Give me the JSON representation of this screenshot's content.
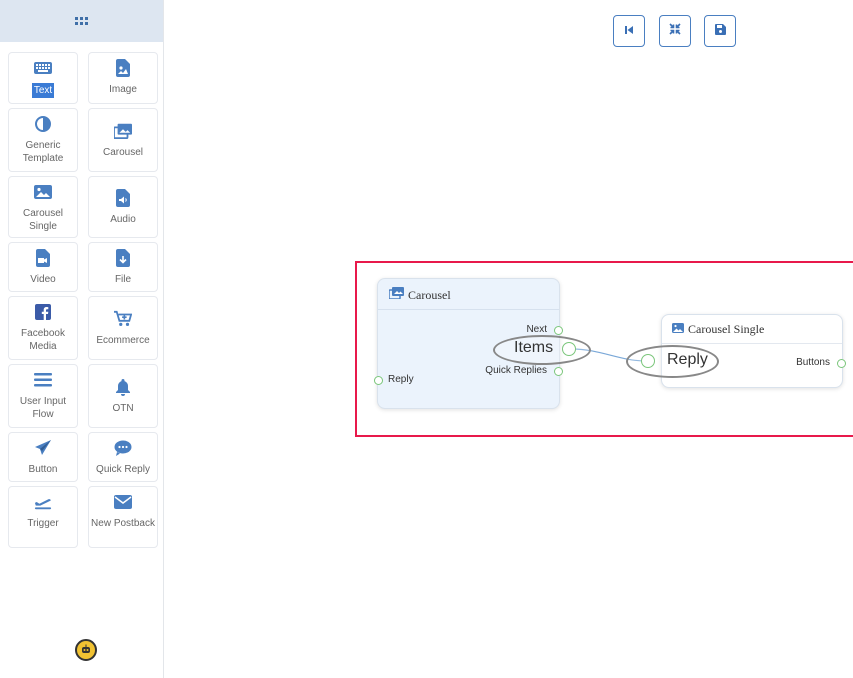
{
  "sidebar": {
    "items": [
      {
        "label": "Text",
        "icon": "keyboard-icon"
      },
      {
        "label": "Image",
        "icon": "image-file-icon"
      },
      {
        "label": "Generic Template",
        "icon": "half-circle-icon"
      },
      {
        "label": "Carousel",
        "icon": "images-icon"
      },
      {
        "label": "Carousel Single",
        "icon": "image-icon"
      },
      {
        "label": "Audio",
        "icon": "audio-file-icon"
      },
      {
        "label": "Video",
        "icon": "video-file-icon"
      },
      {
        "label": "File",
        "icon": "download-file-icon"
      },
      {
        "label": "Facebook Media",
        "icon": "facebook-icon"
      },
      {
        "label": "Ecommerce",
        "icon": "cart-icon"
      },
      {
        "label": "User Input Flow",
        "icon": "bars-icon"
      },
      {
        "label": "OTN",
        "icon": "bell-icon"
      },
      {
        "label": "Button",
        "icon": "paper-plane-icon"
      },
      {
        "label": "Quick Reply",
        "icon": "chat-icon"
      },
      {
        "label": "Trigger",
        "icon": "plane-departure-icon"
      },
      {
        "label": "New Postback",
        "icon": "envelope-icon"
      }
    ]
  },
  "toolbar": {
    "buttons": [
      "first-page-icon",
      "compress-icon",
      "save-icon"
    ]
  },
  "canvas": {
    "carousel_node": {
      "title": "Carousel",
      "ports": {
        "next": "Next",
        "items": "Items",
        "quick_replies": "Quick Replies",
        "reply": "Reply"
      }
    },
    "carousel_single_node": {
      "title": "Carousel Single",
      "ports": {
        "reply": "Reply",
        "buttons": "Buttons"
      }
    }
  },
  "colors": {
    "accent": "#3a7bd5",
    "highlight_frame": "#e8194b",
    "node_bg": "#ebf3fc",
    "port": "#7bc67b"
  }
}
